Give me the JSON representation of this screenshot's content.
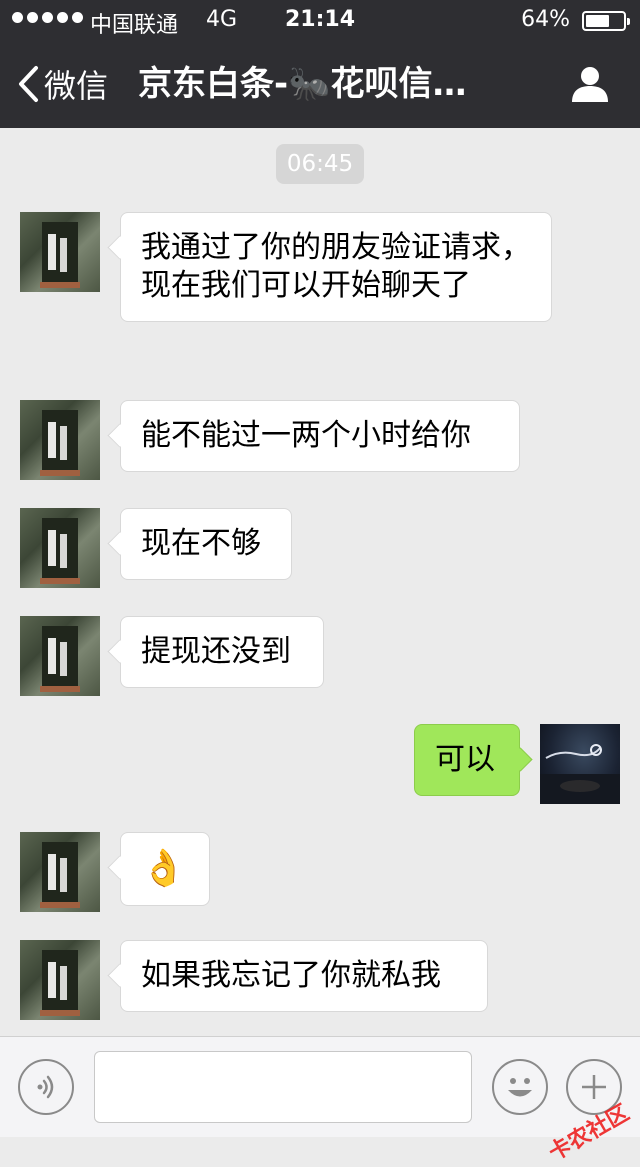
{
  "status_bar": {
    "carrier": "中国联通",
    "network": "4G",
    "time": "21:14",
    "battery_percent_text": "64%",
    "battery_level": 0.64
  },
  "nav": {
    "back_label": "微信",
    "title": "京东白条-🐜花呗信…",
    "back_icon": "chevron-left-icon",
    "profile_icon": "person-icon"
  },
  "chat": {
    "timestamp": "06:45",
    "messages": [
      {
        "from": "friend",
        "text": "我通过了你的朋友验证请求，现在我们可以开始聊天了"
      },
      {
        "from": "friend",
        "text": "能不能过一两个小时给你"
      },
      {
        "from": "friend",
        "text": "现在不够"
      },
      {
        "from": "friend",
        "text": "提现还没到"
      },
      {
        "from": "self",
        "text": "可以"
      },
      {
        "from": "friend",
        "text": "👌"
      },
      {
        "from": "friend",
        "text": "如果我忘记了你就私我"
      }
    ]
  },
  "input_bar": {
    "placeholder": "",
    "voice_icon": "voice-icon",
    "emoji_icon": "emoji-icon",
    "plus_icon": "plus-icon"
  },
  "watermark": "卡农社区",
  "colors": {
    "header_bg": "#2e2e32",
    "chat_bg": "#ebebeb",
    "bubble_in": "#ffffff",
    "bubble_out": "#a0e75a"
  }
}
